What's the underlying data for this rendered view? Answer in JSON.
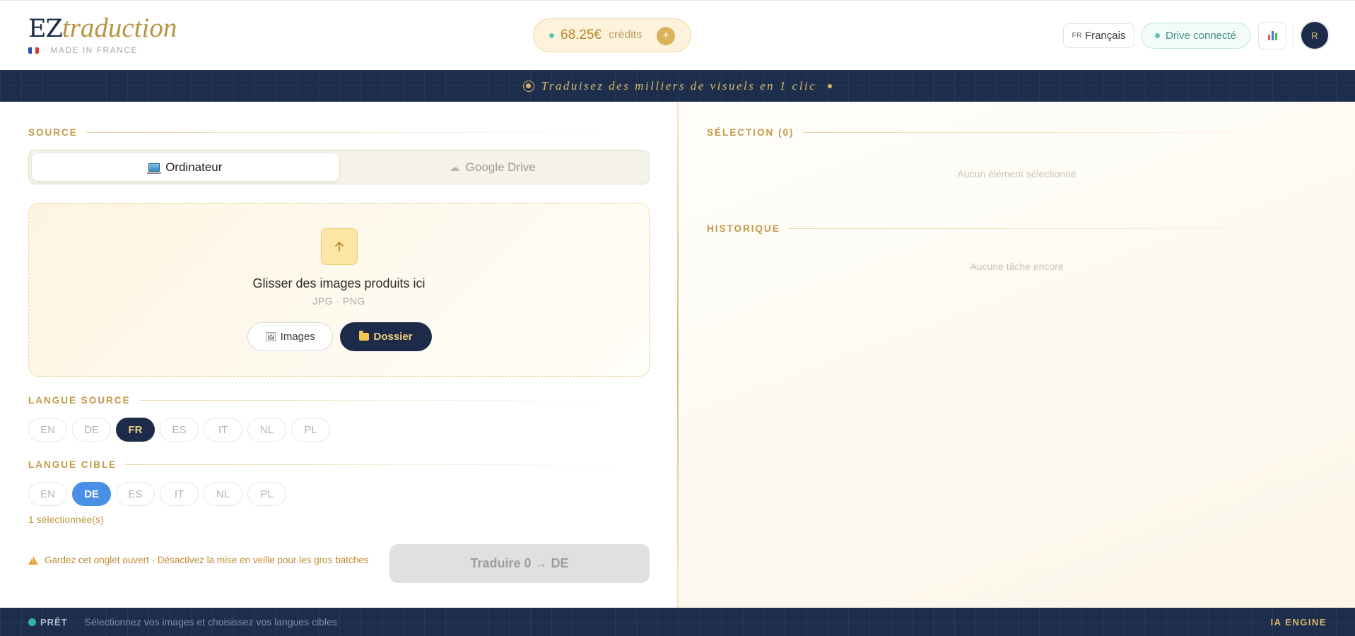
{
  "header": {
    "logo_main": "EZ",
    "logo_italic": "traduction",
    "logo_sub": "· MADE IN FRANCE",
    "credits_amount": "68.25€",
    "credits_label": "crédits",
    "credits_add": "+",
    "language_code": "FR",
    "language_label": "Français",
    "drive_label": "Drive connecté",
    "avatar_initial": "R"
  },
  "banner": {
    "text": "Traduisez des milliers de visuels en 1 clic"
  },
  "source": {
    "title": "SOURCE",
    "tabs": [
      {
        "label": "Ordinateur",
        "active": true
      },
      {
        "label": "Google Drive",
        "active": false
      }
    ],
    "dropzone_title": "Glisser des images produits ici",
    "dropzone_formats": "JPG · PNG",
    "images_button": "Images",
    "folder_button": "Dossier"
  },
  "source_language": {
    "title": "LANGUE SOURCE",
    "options": [
      "EN",
      "DE",
      "FR",
      "ES",
      "IT",
      "NL",
      "PL"
    ],
    "selected": "FR"
  },
  "target_language": {
    "title": "LANGUE CIBLE",
    "options": [
      "EN",
      "DE",
      "ES",
      "IT",
      "NL",
      "PL"
    ],
    "selected": "DE",
    "count_text": "1 sélectionnée(s)"
  },
  "warning_text": "Gardez cet onglet ouvert · Désactivez la mise en veille pour les gros batches",
  "translate_button": "Traduire 0 → DE",
  "selection": {
    "title": "SÉLECTION (0)",
    "empty": "Aucun élément sélectionné"
  },
  "history": {
    "title": "HISTORIQUE",
    "empty": "Aucune tâche encore"
  },
  "footer": {
    "status": "PRÊT",
    "message": "Sélectionnez vos images et choisissez vos langues cibles",
    "engine": "IA ENGINE"
  },
  "colors": {
    "navy": "#1c2b4a",
    "gold": "#c39a46",
    "blue": "#4a8fe6",
    "teal": "#38b2a3"
  }
}
